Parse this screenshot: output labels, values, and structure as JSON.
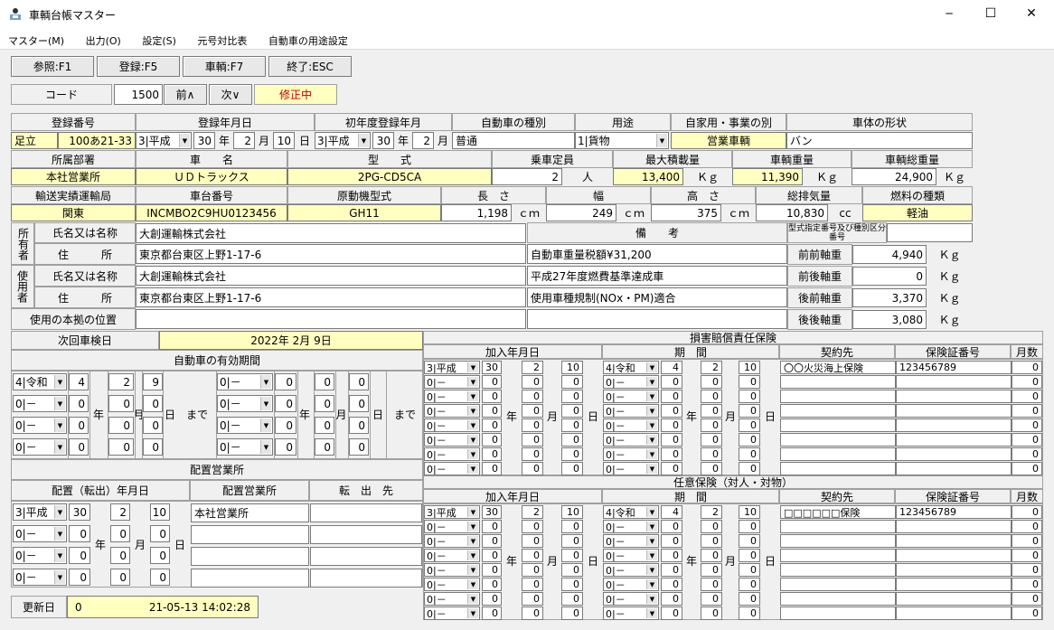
{
  "window": {
    "title": "車輌台帳マスター",
    "min": "─",
    "max": "☐",
    "close": "✕"
  },
  "menu": [
    "マスター(M)",
    "出力(O)",
    "設定(S)",
    "元号対比表",
    "自動車の用途設定"
  ],
  "toolbar": [
    "参照:F1",
    "登録:F5",
    "車輌:F7",
    "終了:ESC"
  ],
  "code": {
    "label": "コード",
    "value": "1500",
    "prev": "前∧",
    "next": "次∨",
    "status": "修正中"
  },
  "row1": {
    "h_reg": "登録番号",
    "h_regdate": "登録年月日",
    "h_first": "初年度登録年月",
    "h_type": "自動車の種別",
    "h_use": "用途",
    "h_own": "自家用・事業の別",
    "h_body": "車体の形状",
    "reg_area": "足立",
    "reg_no": "100あ21-33",
    "regdate_era": "3|平成",
    "regdate_y": "30",
    "regdate_m": "2",
    "regdate_d": "10",
    "first_era": "3|平成",
    "first_y": "30",
    "first_m": "2",
    "type": "普通",
    "use": "1|貨物",
    "own": "営業車輌",
    "body": "バン",
    "yen": "年",
    "getsu": "月",
    "nichi": "日"
  },
  "row2": {
    "h_dept": "所属部署",
    "h_name": "車　　名",
    "h_model": "型　　式",
    "h_cap": "乗車定員",
    "h_maxload": "最大積載量",
    "h_weight": "車輌重量",
    "h_gross": "車輌総重量",
    "dept": "本社営業所",
    "name": "ＵＤトラックス",
    "model": "2PG-CD5CA",
    "cap": "2",
    "cap_unit": "人",
    "maxload": "13,400",
    "weight": "11,390",
    "gross": "24,900",
    "kg": "Ｋｇ"
  },
  "row3": {
    "h_bureau": "輸送実績運輸局",
    "h_chassis": "車台番号",
    "h_engine": "原動機型式",
    "h_len": "長　さ",
    "h_wid": "幅",
    "h_hgt": "高　さ",
    "h_disp": "総排気量",
    "h_fuel": "燃料の種類",
    "bureau": "関東",
    "chassis": "INCMBO2C9HU0123456",
    "engine": "GH11",
    "len": "1,198",
    "wid": "249",
    "hgt": "375",
    "disp": "10,830",
    "fuel": "軽油",
    "cm": "ｃｍ",
    "cc": "cc"
  },
  "owner": {
    "side1": "所有者",
    "side2": "使用者",
    "h_name": "氏名又は名称",
    "h_addr": "住　　　所",
    "name1": "大創運輸株式会社",
    "addr1": "東京都台東区上野1-17-6",
    "name2": "大創運輸株式会社",
    "addr2": "東京都台東区上野1-17-6",
    "h_base": "使用の本拠の位置",
    "base": "",
    "h_note": "備　　考",
    "note1": "自動車重量税額¥31,200",
    "note2": "平成27年度燃費基準達成車",
    "note3": "使用車種規制(NOx・PM)適合",
    "note4": "",
    "h_typeno": "型式指定番号及び種別区分番号",
    "typeno": "",
    "axles": [
      {
        "label": "前前軸重",
        "val": "4,940"
      },
      {
        "label": "前後軸重",
        "val": "0"
      },
      {
        "label": "後前軸重",
        "val": "3,370"
      },
      {
        "label": "後後軸重",
        "val": "3,080"
      }
    ]
  },
  "inspect": {
    "label": "次回車検日",
    "value": "2022年 2月 9日",
    "h_valid": "自動車の有効期間",
    "made": "まで",
    "rows": [
      [
        "4|令和",
        "4",
        "2",
        "9",
        "0|－",
        "0",
        "0",
        "0"
      ],
      [
        "0|－",
        "0",
        "0",
        "0",
        "0|－",
        "0",
        "0",
        "0"
      ],
      [
        "0|－",
        "0",
        "0",
        "0",
        "0|－",
        "0",
        "0",
        "0"
      ],
      [
        "0|－",
        "0",
        "0",
        "0",
        "0|－",
        "0",
        "0",
        "0"
      ]
    ]
  },
  "office": {
    "title": "配置営業所",
    "h_date": "配置（転出）年月日",
    "h_office": "配置営業所",
    "h_dest": "転　出　先",
    "rows": [
      [
        "3|平成",
        "30",
        "2",
        "10",
        "本社営業所",
        ""
      ],
      [
        "0|－",
        "0",
        "0",
        "0",
        "",
        ""
      ],
      [
        "0|－",
        "0",
        "0",
        "0",
        "",
        ""
      ],
      [
        "0|－",
        "0",
        "0",
        "0",
        "",
        ""
      ]
    ]
  },
  "updated": {
    "label": "更新日",
    "value": "0",
    "datetime": "21-05-13 14:02:28"
  },
  "ins1": {
    "title": "損害賠償責任保険",
    "h_join": "加入年月日",
    "h_period": "期　間",
    "h_contract": "契約先",
    "h_policy": "保険証番号",
    "h_months": "月数",
    "rows": [
      [
        "3|平成",
        "30",
        "2",
        "10",
        "4|令和",
        "4",
        "2",
        "10",
        "〇〇火災海上保険",
        "123456789",
        "0"
      ],
      [
        "0|－",
        "0",
        "0",
        "0",
        "0|－",
        "0",
        "0",
        "0",
        "",
        "",
        "0"
      ],
      [
        "0|－",
        "0",
        "0",
        "0",
        "0|－",
        "0",
        "0",
        "0",
        "",
        "",
        "0"
      ],
      [
        "0|－",
        "0",
        "0",
        "0",
        "0|－",
        "0",
        "0",
        "0",
        "",
        "",
        "0"
      ],
      [
        "0|－",
        "0",
        "0",
        "0",
        "0|－",
        "0",
        "0",
        "0",
        "",
        "",
        "0"
      ],
      [
        "0|－",
        "0",
        "0",
        "0",
        "0|－",
        "0",
        "0",
        "0",
        "",
        "",
        "0"
      ],
      [
        "0|－",
        "0",
        "0",
        "0",
        "0|－",
        "0",
        "0",
        "0",
        "",
        "",
        "0"
      ],
      [
        "0|－",
        "0",
        "0",
        "0",
        "0|－",
        "0",
        "0",
        "0",
        "",
        "",
        "0"
      ]
    ]
  },
  "ins2": {
    "title": "任意保険（対人・対物）",
    "h_join": "加入年月日",
    "h_period": "期　間",
    "h_contract": "契約先",
    "h_policy": "保険証番号",
    "h_months": "月数",
    "rows": [
      [
        "3|平成",
        "30",
        "2",
        "10",
        "4|令和",
        "4",
        "2",
        "10",
        "□□□□□□保険",
        "123456789",
        "0"
      ],
      [
        "0|－",
        "0",
        "0",
        "0",
        "0|－",
        "0",
        "0",
        "0",
        "",
        "",
        "0"
      ],
      [
        "0|－",
        "0",
        "0",
        "0",
        "0|－",
        "0",
        "0",
        "0",
        "",
        "",
        "0"
      ],
      [
        "0|－",
        "0",
        "0",
        "0",
        "0|－",
        "0",
        "0",
        "0",
        "",
        "",
        "0"
      ],
      [
        "0|－",
        "0",
        "0",
        "0",
        "0|－",
        "0",
        "0",
        "0",
        "",
        "",
        "0"
      ],
      [
        "0|－",
        "0",
        "0",
        "0",
        "0|－",
        "0",
        "0",
        "0",
        "",
        "",
        "0"
      ],
      [
        "0|－",
        "0",
        "0",
        "0",
        "0|－",
        "0",
        "0",
        "0",
        "",
        "",
        "0"
      ],
      [
        "0|－",
        "0",
        "0",
        "0",
        "0|－",
        "0",
        "0",
        "0",
        "",
        "",
        "0"
      ]
    ]
  }
}
